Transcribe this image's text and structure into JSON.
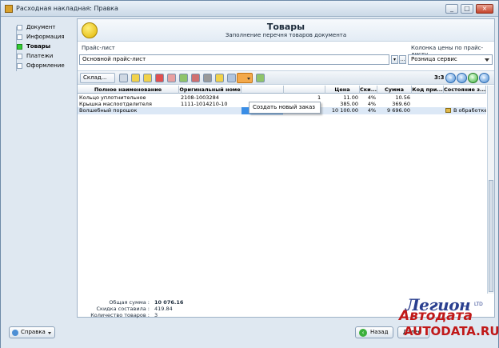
{
  "window": {
    "title": "Расходная накладная: Правка"
  },
  "nav": {
    "items": [
      {
        "label": "Документ",
        "active": false
      },
      {
        "label": "Информация",
        "active": false
      },
      {
        "label": "Товары",
        "active": true
      },
      {
        "label": "Платежи",
        "active": false
      },
      {
        "label": "Оформление",
        "active": false
      }
    ]
  },
  "header": {
    "title": "Товары",
    "subtitle": "Заполнение перечня товаров документа"
  },
  "price_list": {
    "label": "Прайс-лист",
    "value": "Основной прайс-лист"
  },
  "price_column": {
    "label": "Колонка цены по прайс-листу",
    "value": "Розница сервис"
  },
  "toolbar": {
    "warehouse_label": "Склад...",
    "counter": "3:3"
  },
  "popup": {
    "label": "Создать новый заказ"
  },
  "grid": {
    "columns": [
      "Полное наименование",
      "Оригинальный номе",
      "Цена",
      "Ски...",
      "Сумма",
      "Код при...",
      "Состояние з..."
    ],
    "rows": [
      {
        "name": "Кольцо уплотнительное",
        "orig": "2108-1003284",
        "qty": "1",
        "price": "11.00",
        "discount": "4%",
        "sum": "10.56",
        "code": "",
        "status": ""
      },
      {
        "name": "Крышка маслоотделителя",
        "orig": "1111-1014210-10",
        "qty": "1",
        "price": "385.00",
        "discount": "4%",
        "sum": "369.60",
        "code": "",
        "status": ""
      },
      {
        "name": "Волшебный порошок",
        "orig": "",
        "qty": "1",
        "price": "10 100.00",
        "discount": "4%",
        "sum": "9 696.00",
        "code": "",
        "status": "В обработке"
      }
    ]
  },
  "summary": {
    "total_label": "Общая сумма :",
    "total_value": "10 076.16",
    "discount_label": "Скидка составила :",
    "discount_value": "419.84",
    "count_label": "Количество товаров :",
    "count_value": "3"
  },
  "footer": {
    "help_label": "Справка",
    "back_label": "Назад",
    "forward_label": "Далее"
  },
  "watermark": {
    "line1": "Легион",
    "line2": "Автодата",
    "line3": "AUTODATA.RU",
    "ltd": "LTD"
  },
  "colors": {
    "active_nav": "#33cc33",
    "selection": "#3a8ee6",
    "toolbar_active": "#f3a94b",
    "watermark_red": "#c01818",
    "watermark_blue": "#2a3f8f"
  }
}
